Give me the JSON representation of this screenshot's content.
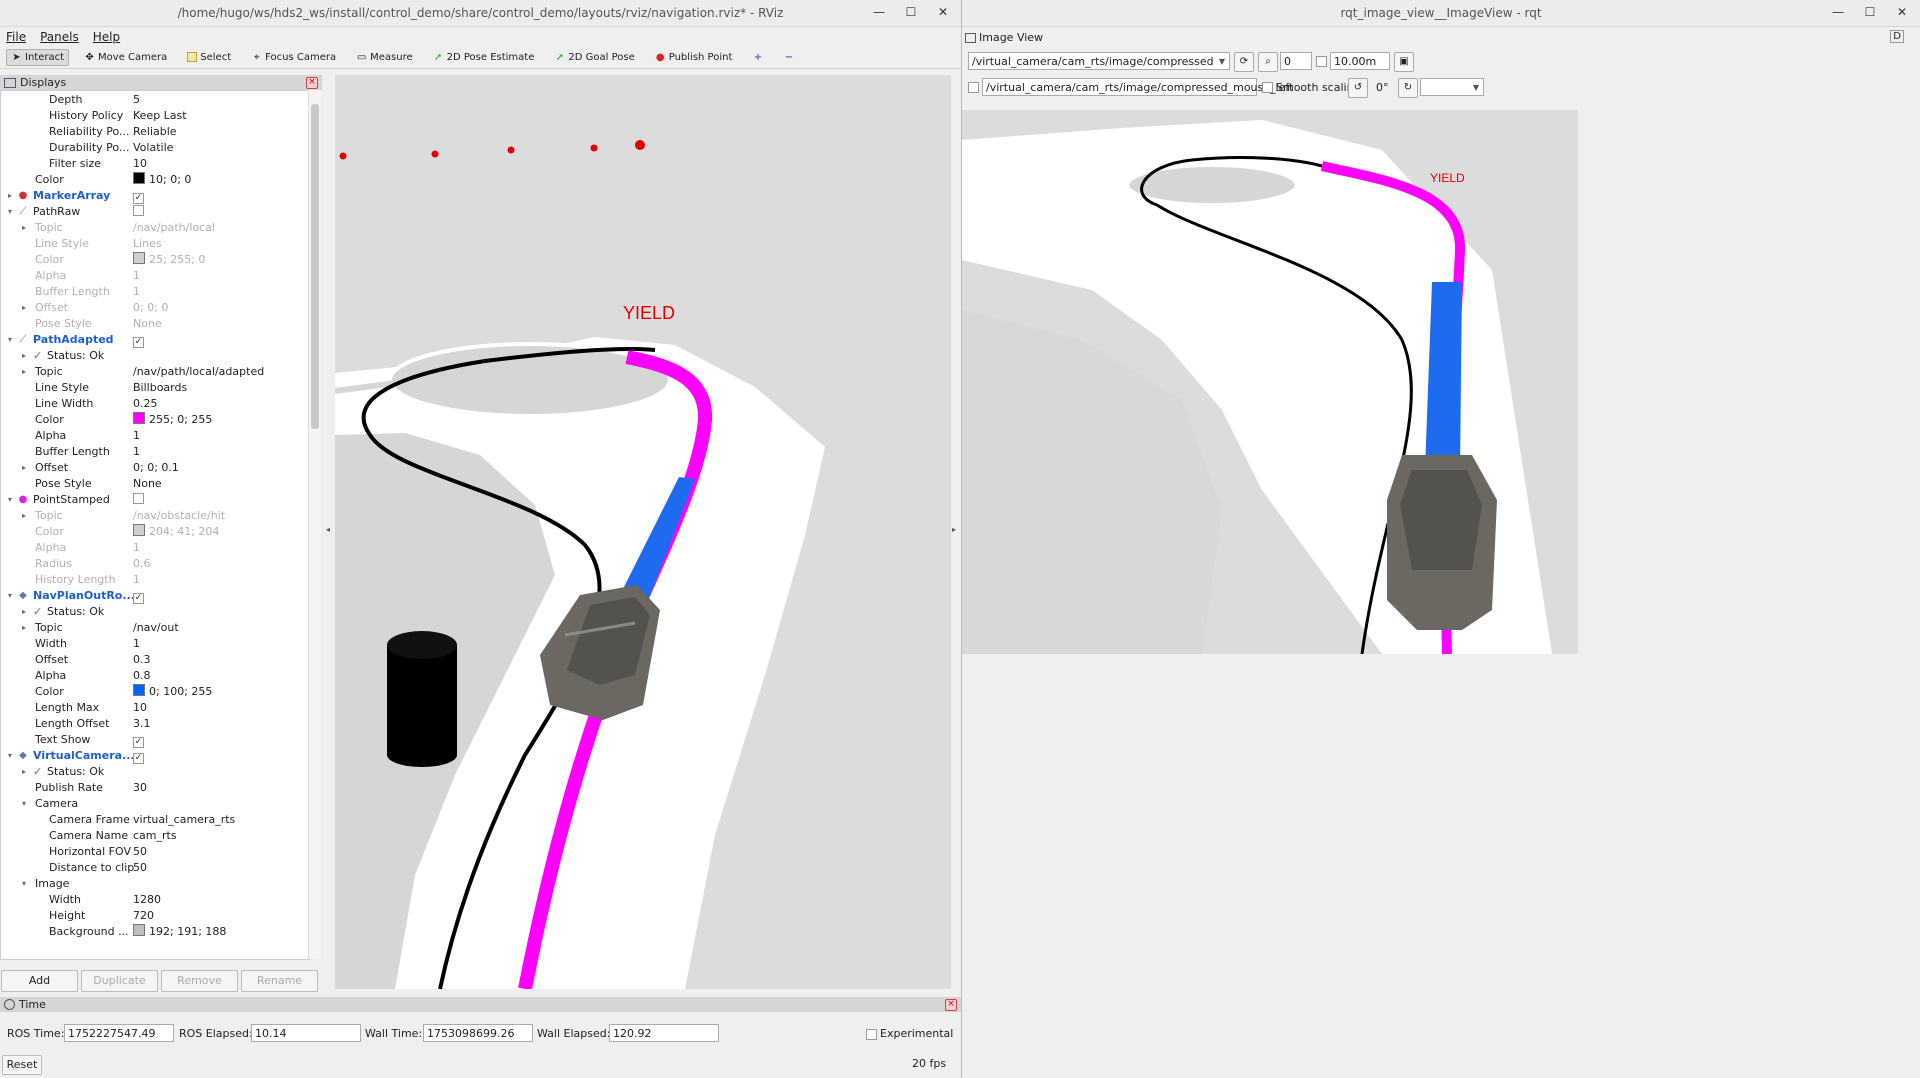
{
  "rviz": {
    "title": "/home/hugo/ws/hds2_ws/install/control_demo/share/control_demo/layouts/rviz/navigation.rviz* - RViz",
    "menu": [
      "File",
      "Panels",
      "Help"
    ],
    "toolbar": [
      {
        "label": "Interact",
        "icon": "cursor-icon"
      },
      {
        "label": "Move Camera",
        "icon": "move-icon"
      },
      {
        "label": "Select",
        "icon": "select-icon"
      },
      {
        "label": "Focus Camera",
        "icon": "focus-icon"
      },
      {
        "label": "Measure",
        "icon": "ruler-icon"
      },
      {
        "label": "2D Pose Estimate",
        "icon": "pose-arrow-icon"
      },
      {
        "label": "2D Goal Pose",
        "icon": "goal-arrow-icon"
      },
      {
        "label": "Publish Point",
        "icon": "pin-icon"
      }
    ],
    "displays_title": "Displays",
    "tree": [
      {
        "k": "Depth",
        "v": "5",
        "indent": 2
      },
      {
        "k": "History Policy",
        "v": "Keep Last",
        "indent": 2
      },
      {
        "k": "Reliability Po...",
        "v": "Reliable",
        "indent": 2
      },
      {
        "k": "Durability Po...",
        "v": "Volatile",
        "indent": 2
      },
      {
        "k": "Filter size",
        "v": "10",
        "indent": 2
      },
      {
        "k": "Color",
        "v": "10; 0; 0",
        "indent": 1,
        "swatch": "#0a0000"
      },
      {
        "k": "MarkerArray",
        "v": "",
        "indent": 0,
        "group": true,
        "check": true,
        "exp": "▸",
        "icon": "●",
        "iconColor": "#c33"
      },
      {
        "k": "PathRaw",
        "v": "",
        "indent": 0,
        "check": false,
        "exp": "▾",
        "icon": "⟋",
        "iconColor": "#2a2"
      },
      {
        "k": "Topic",
        "v": "/nav/path/local",
        "indent": 1,
        "dis": true,
        "exp": "▸"
      },
      {
        "k": "Line Style",
        "v": "Lines",
        "indent": 1,
        "dis": true
      },
      {
        "k": "Color",
        "v": "25; 255; 0",
        "indent": 1,
        "dis": true,
        "swatch": "#cfcfcf"
      },
      {
        "k": "Alpha",
        "v": "1",
        "indent": 1,
        "dis": true
      },
      {
        "k": "Buffer Length",
        "v": "1",
        "indent": 1,
        "dis": true
      },
      {
        "k": "Offset",
        "v": "0; 0; 0",
        "indent": 1,
        "dis": true,
        "exp": "▸"
      },
      {
        "k": "Pose Style",
        "v": "None",
        "indent": 1,
        "dis": true
      },
      {
        "k": "PathAdapted",
        "v": "",
        "indent": 0,
        "group": true,
        "check": true,
        "exp": "▾",
        "icon": "⟋",
        "iconColor": "#2a2"
      },
      {
        "k": "Status: Ok",
        "v": "",
        "indent": 1,
        "exp": "▸",
        "ok": true
      },
      {
        "k": "Topic",
        "v": "/nav/path/local/adapted",
        "indent": 1,
        "exp": "▸"
      },
      {
        "k": "Line Style",
        "v": "Billboards",
        "indent": 1
      },
      {
        "k": "Line Width",
        "v": "0.25",
        "indent": 1
      },
      {
        "k": "Color",
        "v": "255; 0; 255",
        "indent": 1,
        "swatch": "#ff00ff"
      },
      {
        "k": "Alpha",
        "v": "1",
        "indent": 1
      },
      {
        "k": "Buffer Length",
        "v": "1",
        "indent": 1
      },
      {
        "k": "Offset",
        "v": "0; 0; 0.1",
        "indent": 1,
        "exp": "▸"
      },
      {
        "k": "Pose Style",
        "v": "None",
        "indent": 1
      },
      {
        "k": "PointStamped",
        "v": "",
        "indent": 0,
        "check": false,
        "exp": "▾",
        "icon": "●",
        "iconColor": "#d2d"
      },
      {
        "k": "Topic",
        "v": "/nav/obstacle/hit",
        "indent": 1,
        "dis": true,
        "exp": "▸"
      },
      {
        "k": "Color",
        "v": "204; 41; 204",
        "indent": 1,
        "dis": true,
        "swatch": "#cfcfcf"
      },
      {
        "k": "Alpha",
        "v": "1",
        "indent": 1,
        "dis": true
      },
      {
        "k": "Radius",
        "v": "0.6",
        "indent": 1,
        "dis": true
      },
      {
        "k": "History Length",
        "v": "1",
        "indent": 1,
        "dis": true
      },
      {
        "k": "NavPlanOutRo...",
        "v": "",
        "indent": 0,
        "group": true,
        "check": true,
        "exp": "▾",
        "icon": "◆",
        "iconColor": "#5a7ab0"
      },
      {
        "k": "Status: Ok",
        "v": "",
        "indent": 1,
        "exp": "▸",
        "ok": true
      },
      {
        "k": "Topic",
        "v": "/nav/out",
        "indent": 1,
        "exp": "▸"
      },
      {
        "k": "Width",
        "v": "1",
        "indent": 1
      },
      {
        "k": "Offset",
        "v": "0.3",
        "indent": 1
      },
      {
        "k": "Alpha",
        "v": "0.8",
        "indent": 1
      },
      {
        "k": "Color",
        "v": "0; 100; 255",
        "indent": 1,
        "swatch": "#0064ff"
      },
      {
        "k": "Length Max",
        "v": "10",
        "indent": 1
      },
      {
        "k": "Length Offset",
        "v": "3.1",
        "indent": 1
      },
      {
        "k": "Text Show",
        "v": "",
        "indent": 1,
        "check": true
      },
      {
        "k": "VirtualCamera...",
        "v": "",
        "indent": 0,
        "group": true,
        "check": true,
        "exp": "▾",
        "icon": "◆",
        "iconColor": "#5a7ab0"
      },
      {
        "k": "Status: Ok",
        "v": "",
        "indent": 1,
        "exp": "▸",
        "ok": true
      },
      {
        "k": "Publish Rate",
        "v": "30",
        "indent": 1
      },
      {
        "k": "Camera",
        "v": "",
        "indent": 1,
        "exp": "▾"
      },
      {
        "k": "Camera Frame",
        "v": "virtual_camera_rts",
        "indent": 2
      },
      {
        "k": "Camera Name",
        "v": "cam_rts",
        "indent": 2
      },
      {
        "k": "Horizontal FOV",
        "v": "50",
        "indent": 2
      },
      {
        "k": "Distance to clip",
        "v": "50",
        "indent": 2
      },
      {
        "k": "Image",
        "v": "",
        "indent": 1,
        "exp": "▾"
      },
      {
        "k": "Width",
        "v": "1280",
        "indent": 2
      },
      {
        "k": "Height",
        "v": "720",
        "indent": 2
      },
      {
        "k": "Background ...",
        "v": "192; 191; 188",
        "indent": 2,
        "swatch": "#c0bfbc"
      }
    ],
    "buttons": {
      "add": "Add",
      "duplicate": "Duplicate",
      "remove": "Remove",
      "rename": "Rename"
    },
    "scene_label": "YIELD",
    "time": {
      "title": "Time",
      "ros_time_label": "ROS Time:",
      "ros_time": "1752227547.49",
      "ros_elapsed_label": "ROS Elapsed:",
      "ros_elapsed": "10.14",
      "wall_time_label": "Wall Time:",
      "wall_time": "1753098699.26",
      "wall_elapsed_label": "Wall Elapsed:",
      "wall_elapsed": "120.92",
      "experimental": "Experimental",
      "reset": "Reset",
      "fps": "20 fps"
    }
  },
  "rqt": {
    "title": "rqt_image_view__ImageView - rqt",
    "plugin_title": "Image View",
    "help_label": "D",
    "topic": "/virtual_camera/cam_rts/image/compressed",
    "spin_value": "0",
    "max_range": "10.00m",
    "mouse_topic": "/virtual_camera/cam_rts/image/compressed_mouse_left",
    "smooth_scaling": "Smooth scaling",
    "rotation": "0°",
    "scene_label": "YIELD"
  },
  "colors": {
    "path_adapted": "#ff00ff",
    "nav_plan": "#0064ff",
    "path_raw": "#000000",
    "marker": "#e00000",
    "ground": "#dcdcdc",
    "road": "#ffffff"
  }
}
